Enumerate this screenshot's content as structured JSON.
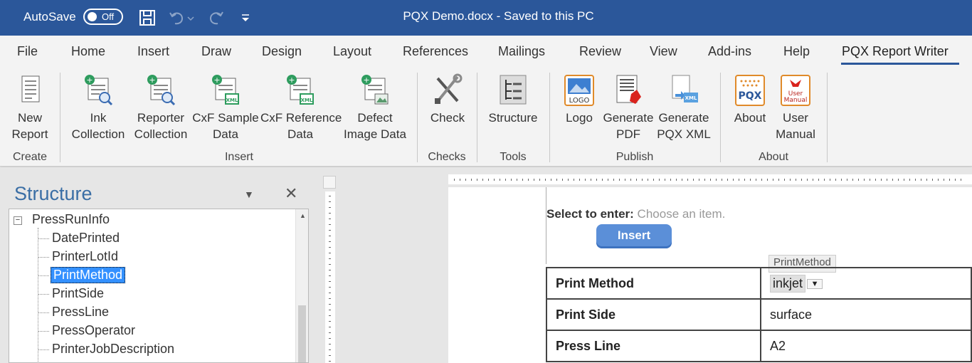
{
  "titlebar": {
    "autosave_label": "AutoSave",
    "autosave_state": "Off",
    "doc_title": "PQX Demo.docx  -  Saved to this PC",
    "icons": [
      "save-icon",
      "undo-icon",
      "redo-icon",
      "customize-qat-icon"
    ]
  },
  "tabs": [
    {
      "label": "File"
    },
    {
      "label": "Home"
    },
    {
      "label": "Insert"
    },
    {
      "label": "Draw"
    },
    {
      "label": "Design"
    },
    {
      "label": "Layout"
    },
    {
      "label": "References"
    },
    {
      "label": "Mailings"
    },
    {
      "label": "Review"
    },
    {
      "label": "View"
    },
    {
      "label": "Add-ins"
    },
    {
      "label": "Help"
    },
    {
      "label": "PQX Report Writer",
      "active": true
    }
  ],
  "ribbon": {
    "groups": [
      {
        "label": "Create"
      },
      {
        "label": "Insert"
      },
      {
        "label": "Checks"
      },
      {
        "label": "Tools"
      },
      {
        "label": "Publish"
      },
      {
        "label": "About"
      }
    ],
    "buttons": [
      {
        "line1": "New",
        "line2": "Report"
      },
      {
        "line1": "Ink",
        "line2": "Collection"
      },
      {
        "line1": "Reporter",
        "line2": "Collection"
      },
      {
        "line1": "CxF Sample",
        "line2": "Data"
      },
      {
        "line1": "CxF Reference",
        "line2": "Data"
      },
      {
        "line1": "Defect",
        "line2": "Image Data"
      },
      {
        "line1": "Check",
        "line2": ""
      },
      {
        "line1": "Structure",
        "line2": ""
      },
      {
        "line1": "Logo",
        "line2": ""
      },
      {
        "line1": "Generate",
        "line2": "PDF"
      },
      {
        "line1": "Generate",
        "line2": "PQX XML"
      },
      {
        "line1": "About",
        "line2": ""
      },
      {
        "line1": "User",
        "line2": "Manual"
      }
    ],
    "icon_text": {
      "logo": "LOGO",
      "pdf_xml": "XML",
      "pqx": "PQX",
      "manual_top": "User",
      "manual_bottom": "Manual"
    }
  },
  "structure_pane": {
    "title": "Structure",
    "root": "PressRunInfo",
    "items": [
      "DatePrinted",
      "PrinterLotId",
      "PrintMethod",
      "PrintSide",
      "PressLine",
      "PressOperator",
      "PrinterJobDescription"
    ],
    "selected": "PrintMethod"
  },
  "document": {
    "select_label": "Select to enter:",
    "select_placeholder": "Choose an item.",
    "insert_button": "Insert",
    "content_control_tag": "PrintMethod",
    "rows": [
      {
        "key": "Print Method",
        "value": "inkjet"
      },
      {
        "key": "Print Side",
        "value": "surface"
      },
      {
        "key": "Press Line",
        "value": "A2"
      }
    ]
  },
  "colors": {
    "titlebar": "#2b579a",
    "accent": "#2b579a",
    "pane_title": "#3a6ea5",
    "selection": "#3390ff",
    "insert_button": "#5b8fd8"
  }
}
